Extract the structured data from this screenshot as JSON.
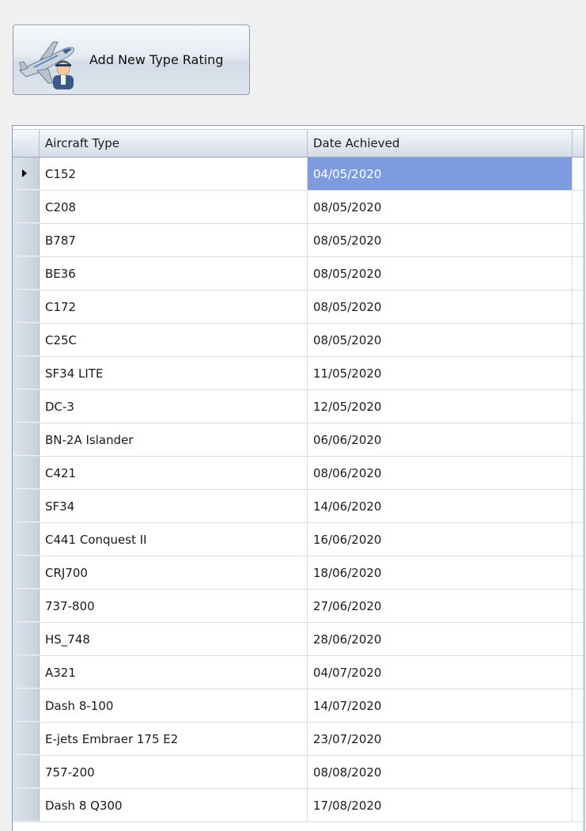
{
  "toolbar": {
    "add_button_label": "Add New Type Rating"
  },
  "grid": {
    "columns": [
      "Aircraft Type",
      "Date Achieved"
    ],
    "selected_row": 0,
    "selection_color": "#7f9be0",
    "rows": [
      {
        "type": "C152",
        "date": "04/05/2020"
      },
      {
        "type": "C208",
        "date": "08/05/2020"
      },
      {
        "type": "B787",
        "date": "08/05/2020"
      },
      {
        "type": "BE36",
        "date": "08/05/2020"
      },
      {
        "type": "C172",
        "date": "08/05/2020"
      },
      {
        "type": "C25C",
        "date": "08/05/2020"
      },
      {
        "type": "SF34 LITE",
        "date": "11/05/2020"
      },
      {
        "type": "DC-3",
        "date": "12/05/2020"
      },
      {
        "type": "BN-2A Islander",
        "date": "06/06/2020"
      },
      {
        "type": "C421",
        "date": "08/06/2020"
      },
      {
        "type": "SF34",
        "date": "14/06/2020"
      },
      {
        "type": "C441 Conquest II",
        "date": "16/06/2020"
      },
      {
        "type": "CRJ700",
        "date": "18/06/2020"
      },
      {
        "type": "737-800",
        "date": "27/06/2020"
      },
      {
        "type": "HS_748",
        "date": "28/06/2020"
      },
      {
        "type": "A321",
        "date": "04/07/2020"
      },
      {
        "type": "Dash 8-100",
        "date": "14/07/2020"
      },
      {
        "type": "E-jets Embraer 175 E2",
        "date": "23/07/2020"
      },
      {
        "type": "757-200",
        "date": "08/08/2020"
      },
      {
        "type": "Dash 8 Q300",
        "date": "17/08/2020"
      }
    ]
  }
}
